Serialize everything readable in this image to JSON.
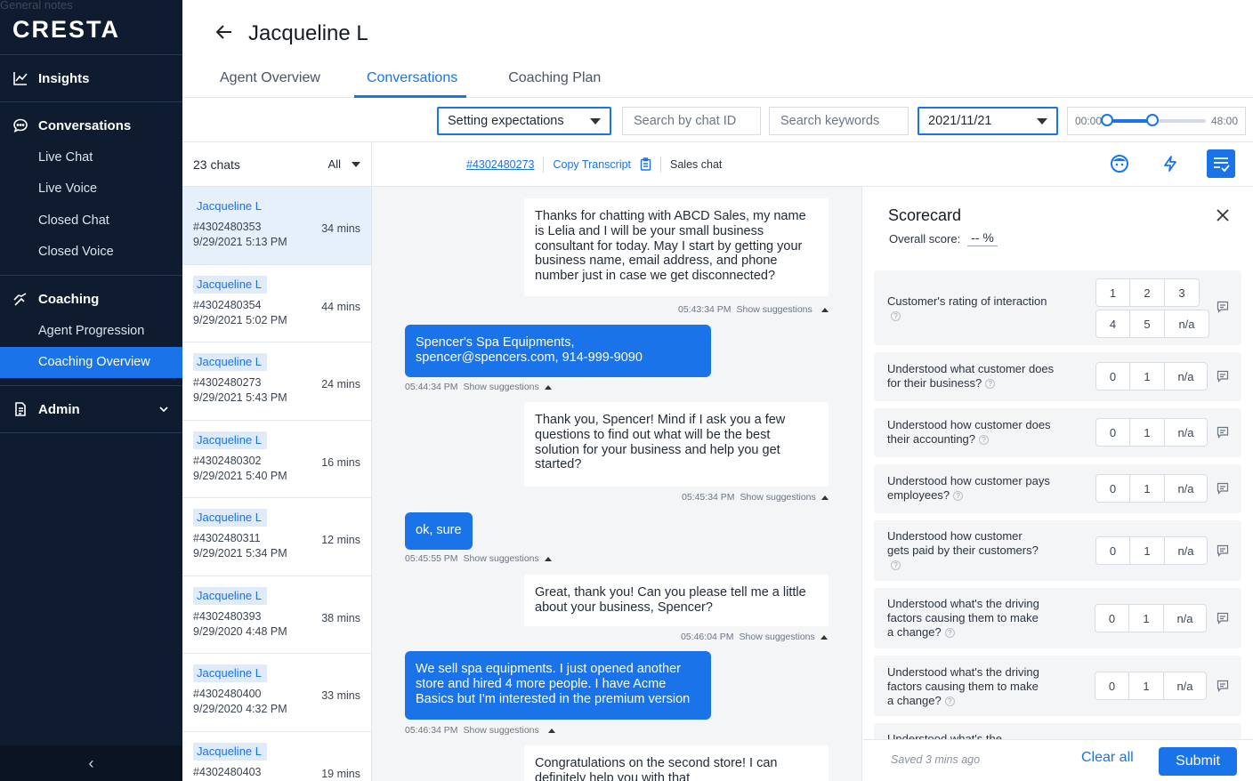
{
  "ghost_text": "General notes",
  "sidebar": {
    "logo": "CRESTA",
    "insights": "Insights",
    "conversations": "Conversations",
    "conversation_items": [
      "Live Chat",
      "Live Voice",
      "Closed Chat",
      "Closed Voice"
    ],
    "coaching": "Coaching",
    "coaching_items": [
      "Agent Progression",
      "Coaching Overview"
    ],
    "admin": "Admin",
    "collapse": "‹"
  },
  "header": {
    "title": "Jacqueline L",
    "tabs": [
      "Agent Overview",
      "Conversations",
      "Coaching Plan"
    ]
  },
  "filters": {
    "topic": "Setting expectations",
    "chat_id_placeholder": "Search by chat ID",
    "keywords_placeholder": "Search keywords",
    "date": "2021/11/21",
    "time_start": "00:00",
    "time_end": "48:00",
    "range_low": 0,
    "range_high": 0.46
  },
  "chatlist": {
    "count": "23 chats",
    "filter": "All",
    "chats": [
      {
        "name": "Jacqueline L",
        "id": "#4302480353",
        "date": "9/29/2021 5:13 PM",
        "mins": "34 mins"
      },
      {
        "name": "Jacqueline L",
        "id": "#4302480354",
        "date": "9/29/2021 5:02 PM",
        "mins": "44 mins"
      },
      {
        "name": "Jacqueline L",
        "id": "#4302480273",
        "date": "9/29/2021 5:43 PM",
        "mins": "24 mins"
      },
      {
        "name": "Jacqueline L",
        "id": "#4302480302",
        "date": "9/29/2021 5:40 PM",
        "mins": "16 mins"
      },
      {
        "name": "Jacqueline L",
        "id": "#4302480311",
        "date": "9/29/2021 5:34 PM",
        "mins": "12 mins"
      },
      {
        "name": "Jacqueline L",
        "id": "#4302480393",
        "date": "9/29/2020 4:48 PM",
        "mins": "38 mins"
      },
      {
        "name": "Jacqueline L",
        "id": "#4302480400",
        "date": "9/29/2020 4:32 PM",
        "mins": "33 mins"
      },
      {
        "name": "Jacqueline L",
        "id": "#4302480403",
        "date": "",
        "mins": "19 mins"
      }
    ]
  },
  "conversation": {
    "chat_id": "#4302480273",
    "copy_label": "Copy Transcript",
    "type": "Sales chat",
    "show_suggestions": "Show suggestions",
    "messages": [
      {
        "from": "agent",
        "text": "Thanks for chatting with ABCD Sales, my name is Lelia and I will be your small business consultant for today. May I start by getting your business name, email address, and phone number just in case we get disconnected?",
        "time": "05:43:34 PM"
      },
      {
        "from": "customer",
        "text": "Spencer's Spa Equipments, spencer@spencers.com, 914-999-9090",
        "time": "05:44:34 PM"
      },
      {
        "from": "agent",
        "text": "Thank you, Spencer! Mind if I ask you a few questions to find out what will be the best solution for your business and help you get started?",
        "time": "05:45:34 PM"
      },
      {
        "from": "customer",
        "text": "ok, sure",
        "time": "05:45:55 PM"
      },
      {
        "from": "agent",
        "text": "Great, thank you! Can you please tell me a little about your business, Spencer?",
        "time": "05:46:04 PM"
      },
      {
        "from": "customer",
        "text": "We sell spa equipments. I just opened another store and hired 4 more people. I have Acme Basics but I'm interested in the premium version",
        "time": "05:46:34 PM"
      },
      {
        "from": "agent",
        "text": "Congratulations on the second store! I can definitely help you with that",
        "time": ""
      }
    ]
  },
  "scorecard": {
    "title": "Scorecard",
    "overall_label": "Overall score:",
    "overall_value": "-- %",
    "questions": [
      {
        "text": "Customer's rating of interaction",
        "options": [
          "1",
          "2",
          "3",
          "4",
          "5",
          "n/a"
        ]
      },
      {
        "text": "Understood what customer does for their business?",
        "options": [
          "0",
          "1",
          "n/a"
        ]
      },
      {
        "text": "Understood how customer does their accounting?",
        "options": [
          "0",
          "1",
          "n/a"
        ]
      },
      {
        "text": "Understood how customer pays employees?",
        "options": [
          "0",
          "1",
          "n/a"
        ]
      },
      {
        "text": "Understood how customer gets paid by their customers?",
        "options": [
          "0",
          "1",
          "n/a"
        ]
      },
      {
        "text": "Understood what's the driving factors causing them to make a change?",
        "options": [
          "0",
          "1",
          "n/a"
        ]
      },
      {
        "text": "Understood what's the driving factors causing them to make a change?",
        "options": [
          "0",
          "1",
          "n/a"
        ]
      },
      {
        "text": "Understood what's the",
        "options": []
      }
    ],
    "saved": "Saved 3 mins ago",
    "clear": "Clear all",
    "submit": "Submit"
  },
  "colors": {
    "accent": "#1a73e8",
    "sidebar": "#0f1b2e"
  }
}
